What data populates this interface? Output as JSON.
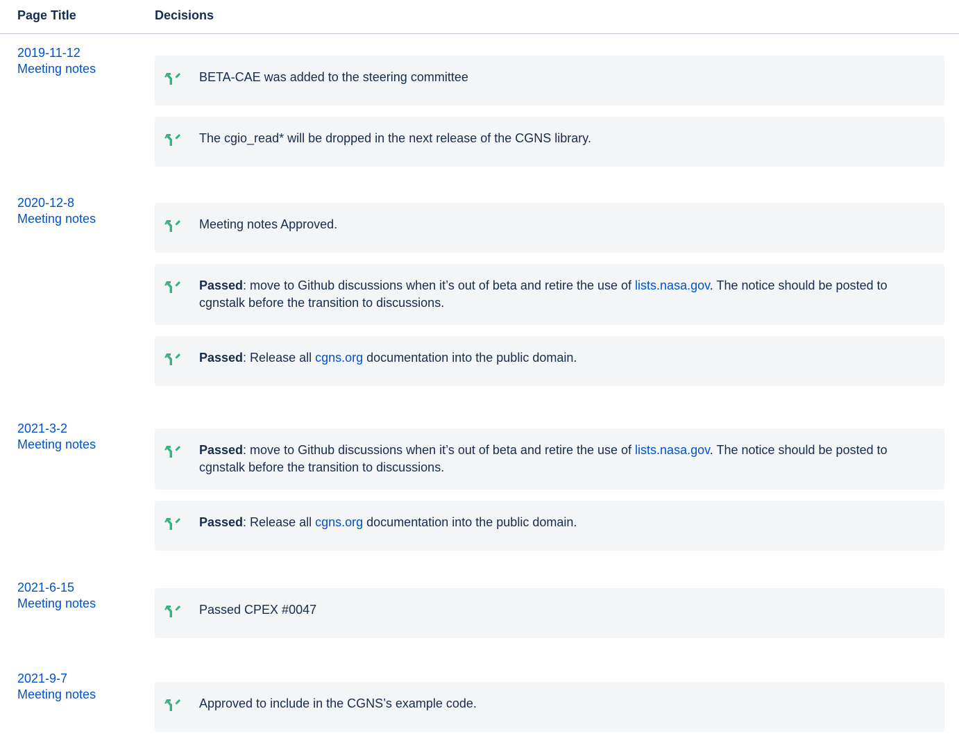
{
  "header": {
    "col_title": "Page Title",
    "col_decisions": "Decisions"
  },
  "rows": [
    {
      "date": "2019-11-12",
      "link": "Meeting notes",
      "decisions": [
        {
          "text": "BETA-CAE was added to the steering committee"
        },
        {
          "text": "The cgio_read* will be dropped in the next release of the CGNS library."
        }
      ]
    },
    {
      "date": "2020-12-8",
      "link": "Meeting notes",
      "decisions": [
        {
          "text": "Meeting notes Approved."
        },
        {
          "bold": "Passed",
          "pre": ": move to Github discussions when it’s out of beta and retire the use of ",
          "link": "lists.nasa.gov",
          "post": ". The notice should be posted to cgnstalk before the transition to discussions."
        },
        {
          "bold": "Passed",
          "pre": ": Release all ",
          "link": "cgns.org",
          "post": " documentation into the public domain."
        }
      ]
    },
    {
      "date": "2021-3-2",
      "link": "Meeting notes",
      "decisions": [
        {
          "bold": "Passed",
          "pre": ": move to Github discussions when it’s out of beta and retire the use of ",
          "link": "lists.nasa.gov",
          "post": ". The notice should be posted to cgnstalk before the transition to discussions."
        },
        {
          "bold": "Passed",
          "pre": ": Release all ",
          "link": "cgns.org",
          "post": " documentation into the public domain."
        }
      ]
    },
    {
      "date": "2021-6-15",
      "link": "Meeting notes",
      "decisions": [
        {
          "text": "Passed CPEX #0047"
        }
      ]
    },
    {
      "date": "2021-9-7",
      "link": "Meeting notes",
      "decisions": [
        {
          "text": "Approved to include in the CGNS’s example code."
        }
      ]
    }
  ],
  "icon": {
    "name": "decision-icon",
    "color": "#36b37e"
  },
  "colors": {
    "link": "#0052cc",
    "text": "#172b4d",
    "panel": "#f4f5f7"
  }
}
